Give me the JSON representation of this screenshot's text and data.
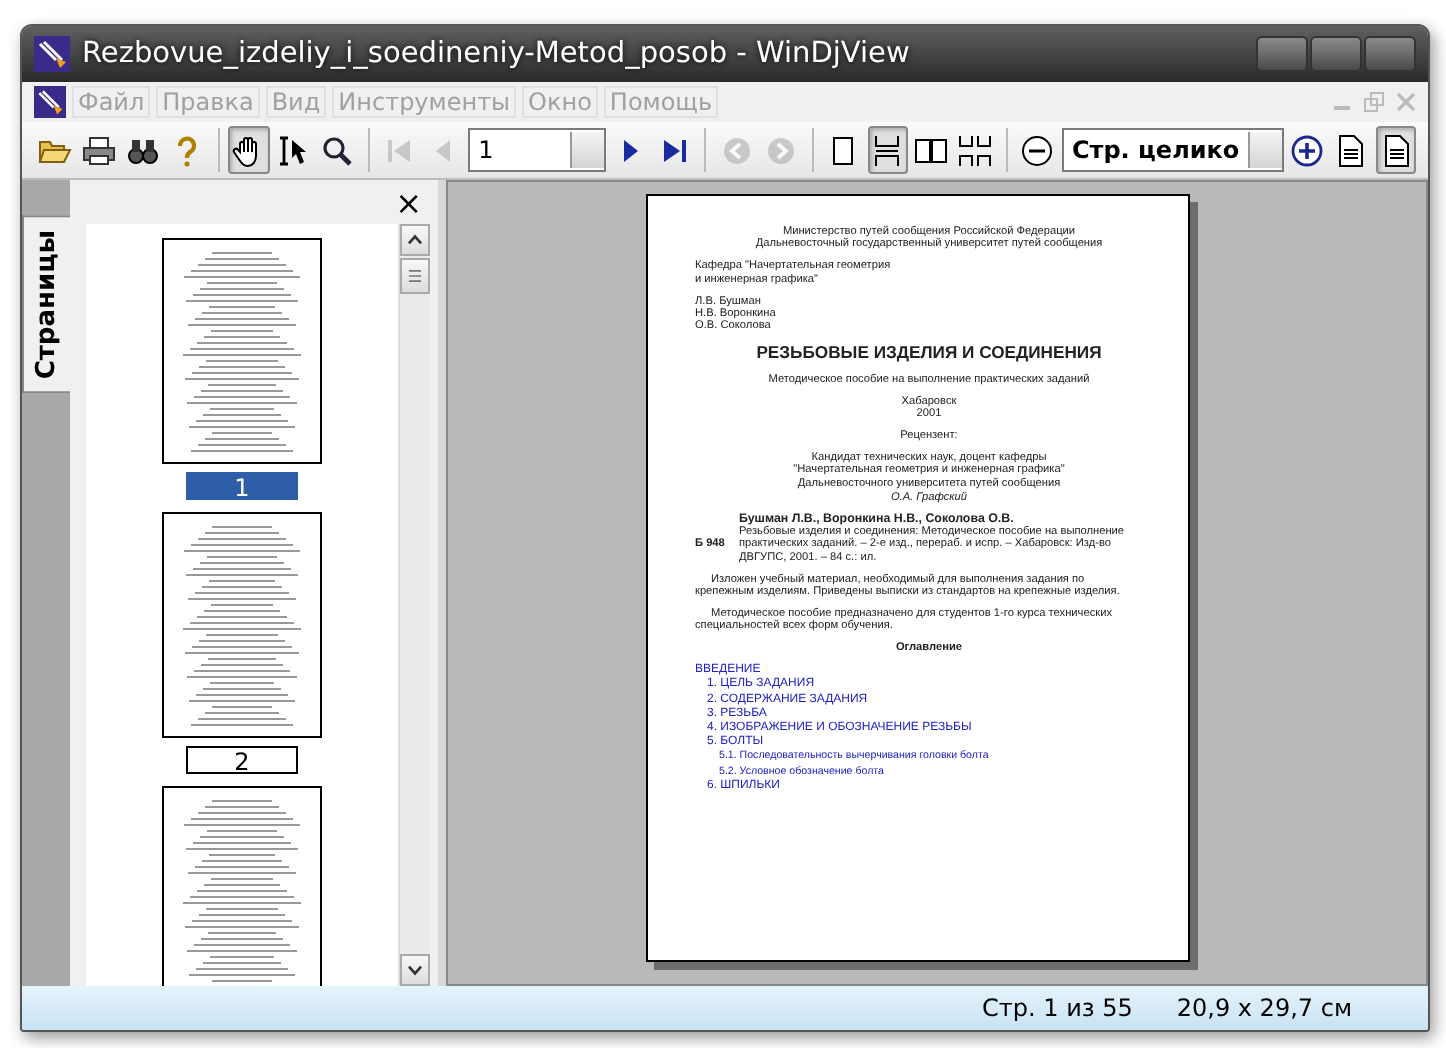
{
  "window": {
    "title": "Rezbovue_izdeliy_i_soedineniy-Metod_posob - WinDjView"
  },
  "menu": [
    "Файл",
    "Правка",
    "Вид",
    "Инструменты",
    "Окно",
    "Помощь"
  ],
  "toolbar": [
    {
      "kind": "open",
      "selected": false,
      "disabled": false
    },
    {
      "kind": "print",
      "selected": false,
      "disabled": false
    },
    {
      "kind": "find",
      "selected": false,
      "disabled": false
    },
    {
      "kind": "help",
      "selected": false,
      "disabled": false
    },
    {
      "kind": "sep"
    },
    {
      "kind": "hand",
      "selected": true,
      "disabled": false
    },
    {
      "kind": "select",
      "selected": false,
      "disabled": false
    },
    {
      "kind": "zoom",
      "selected": false,
      "disabled": false
    },
    {
      "kind": "sep"
    },
    {
      "kind": "first",
      "selected": false,
      "disabled": true
    },
    {
      "kind": "prev",
      "selected": false,
      "disabled": true
    },
    {
      "kind": "page-combo",
      "value": "1"
    },
    {
      "kind": "next",
      "selected": false,
      "disabled": false
    },
    {
      "kind": "last",
      "selected": false,
      "disabled": false
    },
    {
      "kind": "sep"
    },
    {
      "kind": "back",
      "selected": false,
      "disabled": true
    },
    {
      "kind": "forward",
      "selected": false,
      "disabled": true
    },
    {
      "kind": "sep"
    },
    {
      "kind": "single",
      "selected": false,
      "disabled": false
    },
    {
      "kind": "continuous",
      "selected": true,
      "disabled": false
    },
    {
      "kind": "facing",
      "selected": false,
      "disabled": false
    },
    {
      "kind": "facing-continuous",
      "selected": false,
      "disabled": false
    },
    {
      "kind": "sep"
    },
    {
      "kind": "zoom-out",
      "selected": false,
      "disabled": false
    },
    {
      "kind": "zoom-combo",
      "value": "Стр. целико"
    },
    {
      "kind": "zoom-in",
      "selected": false,
      "disabled": false
    },
    {
      "kind": "page",
      "selected": false,
      "disabled": false
    },
    {
      "kind": "page",
      "selected": true,
      "disabled": false
    }
  ],
  "sidebar": {
    "tab": "Страницы",
    "close": "×",
    "thumbnails": [
      {
        "kind": "full",
        "label": "1",
        "selected": true
      },
      {
        "kind": "full",
        "label": "2",
        "selected": false
      },
      {
        "kind": "partial"
      }
    ]
  },
  "document": {
    "blocks": [
      {
        "kind": "center",
        "lines": [
          "Министерство путей сообщения Российской Федерации",
          "Дальневосточный государственный университет путей сообщения"
        ]
      },
      {
        "kind": "left",
        "lines": [
          "Кафедра \"Начертательная геометрия",
          "и инженерная графика\""
        ]
      },
      {
        "kind": "left",
        "lines": [
          "Л.В. Бушман",
          "Н.В. Воронкина",
          "О.В. Соколова"
        ]
      },
      {
        "kind": "title",
        "lines": [
          "РЕЗЬБОВЫЕ ИЗДЕЛИЯ И СОЕДИНЕНИЯ"
        ]
      },
      {
        "kind": "center",
        "lines": [
          "Методическое пособие на выполнение практических заданий"
        ]
      },
      {
        "kind": "center",
        "lines": [
          "Хабаровск",
          "2001"
        ]
      },
      {
        "kind": "center",
        "lines": [
          "Рецензент:"
        ]
      },
      {
        "kind": "center",
        "lines": [
          "Кандидат технических наук, доцент кафедры",
          "\"Начертательная геометрия и инженерная графика\"",
          "Дальневосточного университета путей сообщения"
        ]
      },
      {
        "kind": "signature",
        "lines": [
          "О.А. Графский"
        ]
      },
      {
        "kind": "bib",
        "code": "Б 948",
        "authors": "Бушман Л.В., Воронкина Н.В., Соколова О.В.",
        "lines": [
          "Резьбовые изделия и соединения: Методическое пособие на выполнение",
          "практических заданий. – 2-е изд., перераб. и испр. – Хабаровск: Изд-во",
          "ДВГУПС, 2001. – 84 с.: ил."
        ]
      },
      {
        "kind": "para",
        "lines": [
          "Изложен учебный материал, необходимый для выполнения задания по крепежным изделиям. Приведены выписки из стандартов на крепежные изделия."
        ]
      },
      {
        "kind": "para",
        "lines": [
          "Методическое пособие предназначено для студентов 1-го курса технических специальностей всех форм обучения."
        ]
      },
      {
        "kind": "heading",
        "lines": [
          "Оглавление"
        ]
      }
    ],
    "toc": [
      {
        "text": "ВВЕДЕНИЕ",
        "children": [
          {
            "text": "1. ЦЕЛЬ ЗАДАНИЯ"
          },
          {
            "text": "2. СОДЕРЖАНИЕ ЗАДАНИЯ"
          },
          {
            "text": "3. РЕЗЬБА"
          },
          {
            "text": "4. ИЗОБРАЖЕНИЕ И ОБОЗНАЧЕНИЕ РЕЗЬБЫ"
          },
          {
            "text": "5. БОЛТЫ",
            "children": [
              {
                "text": "5.1. Последовательность вычерчивания головки болта"
              },
              {
                "text": "5.2. Условное обозначение болта"
              }
            ]
          },
          {
            "text": "6. ШПИЛЬКИ"
          }
        ]
      }
    ]
  },
  "status_bar": [
    "Стр. 1 из 55",
    "20,9 x 29,7 см"
  ]
}
